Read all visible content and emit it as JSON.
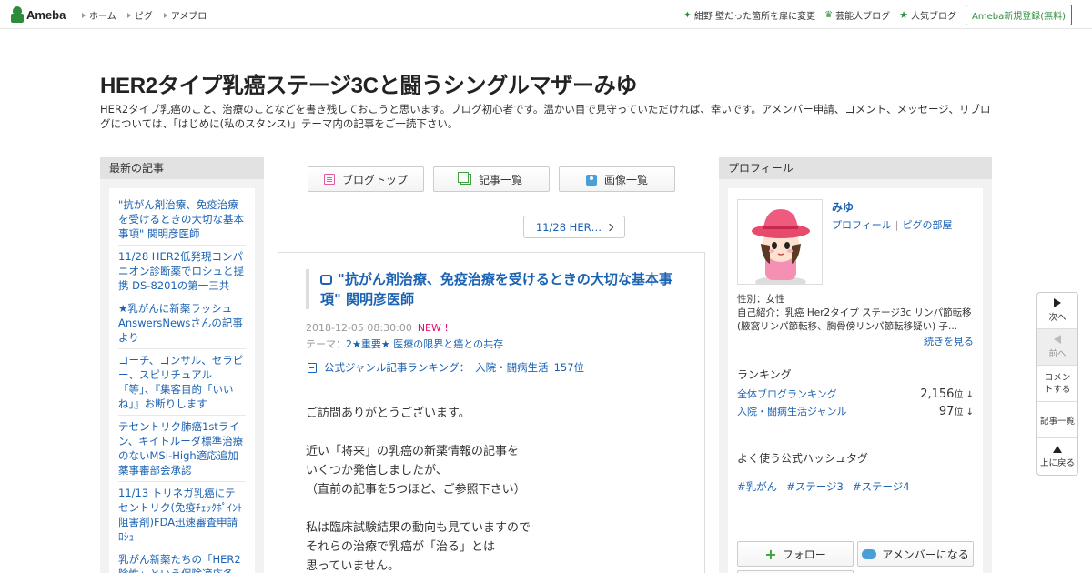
{
  "header": {
    "logo_text": "Ameba",
    "nav": [
      "ホーム",
      "ピグ",
      "アメブロ"
    ],
    "news": "紺野 壁だった箇所を扉に変更",
    "celeb": "芸能人ブログ",
    "popular": "人気ブログ",
    "register": "Ameba新規登録(無料)"
  },
  "blog": {
    "title": "HER2タイプ乳癌ステージ3Cと闘うシングルマザーみゆ",
    "description": "HER2タイプ乳癌のこと、治療のことなどを書き残しておこうと思います。ブログ初心者です。温かい目で見守っていただければ、幸いです。アメンバー申請、コメント、メッセージ、リブログについては、「はじめに(私のスタンス)」テーマ内の記事をご一読下さい。"
  },
  "sidebar_left": {
    "heading": "最新の記事",
    "entries": [
      "\"抗がん剤治療、免疫治療を受けるときの大切な基本事項\" 関明彦医師",
      "11/28 HER2低発現コンパニオン診断薬でロシュと提携 DS-8201の第一三共",
      "★乳がんに新薬ラッシュ AnswersNewsさんの記事より",
      "コーチ、コンサル、セラピー、スピリチュアル「等」、『集客目的「いいね」』お断りします",
      "テセントリク肺癌1stライン、キイトルーダ標準治療のないMSI-High適応追加 薬事審部会承認",
      "11/13 トリネガ乳癌にテセントリク(免疫ﾁｪｯｸﾎﾟｲﾝﾄ阻害剤)FDA迅速審査申請 ﾛｼｭ",
      "乳がん新薬たちの「HER2陰性」という保険適応条"
    ]
  },
  "center_nav": {
    "top": "ブログトップ",
    "list": "記事一覧",
    "images": "画像一覧",
    "next_post": "11/28 HER…"
  },
  "article": {
    "title": "\"抗がん剤治療、免疫治療を受けるときの大切な基本事項\" 関明彦医師",
    "date": "2018-12-05 08:30:00",
    "new_badge": "NEW !",
    "theme_label": "テーマ：",
    "theme": "2★重要★ 医療の限界と癌との共存",
    "ranking_label": "公式ジャンル記事ランキング：",
    "ranking_genre": "入院・闘病生活",
    "ranking_pos": "157位",
    "body": "ご訪問ありがとうございます。\n\n近い「将来」の乳癌の新薬情報の記事を\nいくつか発信しましたが、\n（直前の記事を5つほど、ご参照下さい）\n\n私は臨床試験結果の動向も見ていますので\nそれらの治療で乳癌が「治る」とは\n思っていません。"
  },
  "profile": {
    "heading": "プロフィール",
    "name": "みゆ",
    "link_profile": "プロフィール",
    "link_room": "ピグの部屋",
    "gender": "性別：女性",
    "intro": "自己紹介：乳癌 Her2タイプ ステージ3c リンパ節転移 (腋窩リンパ節転移、胸骨傍リンパ節転移疑い) 子...",
    "readmore": "続きを見る",
    "ranking_heading": "ランキング",
    "rank_all_label": "全体ブログランキング",
    "rank_all_value": "2,156",
    "rank_genre_label": "入院・闘病生活ジャンル",
    "rank_genre_value": "97",
    "rank_unit": "位 ↓",
    "hash_heading": "よく使う公式ハッシュタグ",
    "hashtags": [
      "#乳がん",
      "#ステージ3",
      "#ステージ4"
    ],
    "follow": "フォロー",
    "amember": "アメンバーになる"
  },
  "floatnav": {
    "next": "次へ",
    "prev": "前へ",
    "comment": "コメントする",
    "list": "記事一覧",
    "top": "上に戻る"
  }
}
